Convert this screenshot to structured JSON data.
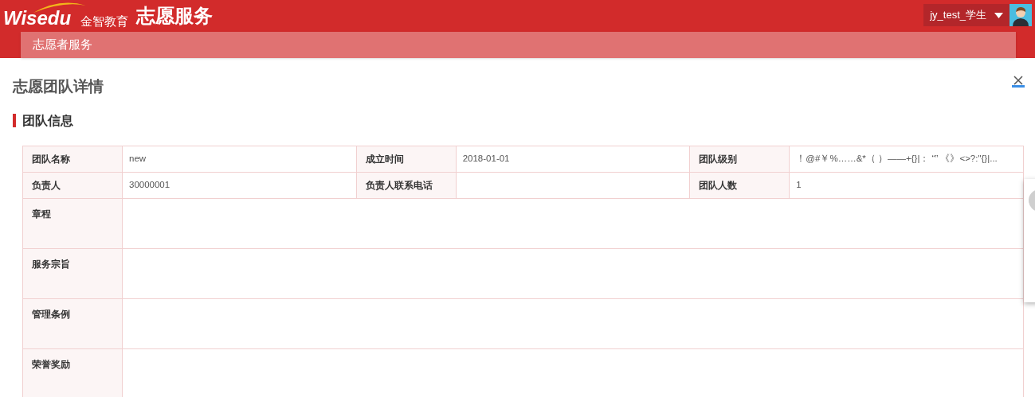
{
  "header": {
    "logo": "Wisedu",
    "logo_subtitle": "金智教育",
    "app_title": "志愿服务",
    "user": "jy_test_学生"
  },
  "nav": {
    "items": [
      {
        "label": "志愿者服务",
        "selected": true
      }
    ]
  },
  "page": {
    "title": "志愿团队详情",
    "section": "团队信息"
  },
  "info_rows": [
    {
      "cells": [
        {
          "label": "团队名称",
          "value": "new"
        },
        {
          "label": "成立时间",
          "value": "2018-01-01"
        },
        {
          "label": "团队级别",
          "value": "！@#￥%……&*（ ）——+{}|： “” 《》<>?:\"{}|..."
        }
      ]
    },
    {
      "cells": [
        {
          "label": "负责人",
          "value": "30000001"
        },
        {
          "label": "负责人联系电话"
        },
        {
          "label": "团队人数",
          "value": "1"
        }
      ]
    }
  ],
  "text_rows": [
    {
      "label": "章程"
    },
    {
      "label": "服务宗旨"
    },
    {
      "label": "管理条例"
    },
    {
      "label": "荣誉奖励"
    }
  ]
}
